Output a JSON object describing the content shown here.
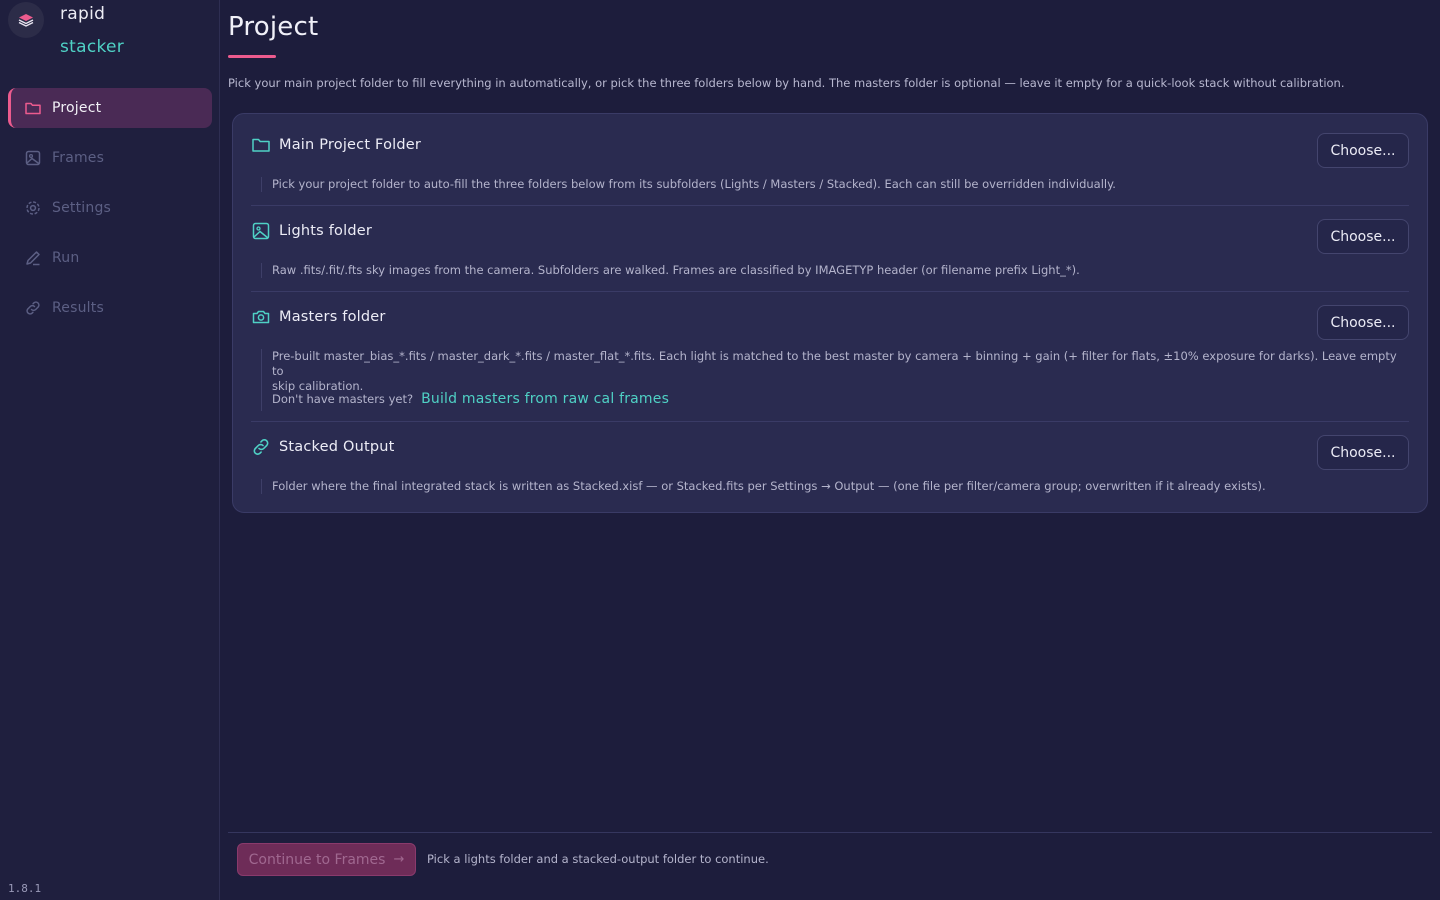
{
  "brand": {
    "line1": "rapid",
    "line2": "stacker",
    "logo_icon": "layers-icon"
  },
  "sidebar": {
    "items": [
      {
        "label": "Project",
        "icon": "folder-icon",
        "active": true
      },
      {
        "label": "Frames",
        "icon": "image-icon",
        "active": false
      },
      {
        "label": "Settings",
        "icon": "gear-icon",
        "active": false
      },
      {
        "label": "Run",
        "icon": "pen-icon",
        "active": false
      },
      {
        "label": "Results",
        "icon": "link-icon",
        "active": false
      }
    ],
    "version": "1.8.1"
  },
  "main": {
    "title": "Project",
    "intro": "Pick your main project folder to fill everything in automatically, or pick the three folders below by hand. The masters folder is optional — leave it empty for a quick-look stack without calibration.",
    "sections": [
      {
        "title": "Main Project Folder",
        "icon": "folder-icon",
        "button": "Choose...",
        "desc": "Pick your project folder to auto-fill the three folders below from its subfolders (Lights / Masters / Stacked). Each can still be overridden individually."
      },
      {
        "title": "Lights folder",
        "icon": "image-icon",
        "button": "Choose...",
        "desc": "Raw .fits/.fit/.fts sky images from the camera. Subfolders are walked. Frames are classified by IMAGETYP header (or filename prefix Light_*)."
      },
      {
        "title": "Masters folder",
        "icon": "camera-icon",
        "button": "Choose...",
        "desc_line1": "Pre-built master_bias_*.fits / master_dark_*.fits / master_flat_*.fits. Each light is matched to the best master by camera + binning + gain (+ filter for flats, ±10% exposure for darks). Leave empty to",
        "desc_line2": "skip calibration.",
        "prompt": "Don't have masters yet?",
        "link": "Build masters from raw cal frames"
      },
      {
        "title": "Stacked Output",
        "icon": "link-icon",
        "button": "Choose...",
        "desc": "Folder where the final integrated stack is written as Stacked.xisf — or Stacked.fits per Settings → Output — (one file per filter/camera group; overwritten if it already exists)."
      }
    ]
  },
  "footer": {
    "continue_label": "Continue to Frames",
    "continue_arrow": "→",
    "hint": "Pick a lights folder and a stacked-output folder to continue."
  },
  "colors": {
    "accent_pink": "#ec5b8e",
    "accent_teal": "#4fd1c5",
    "background": "#1d1d3c",
    "card": "#2a2b50"
  }
}
